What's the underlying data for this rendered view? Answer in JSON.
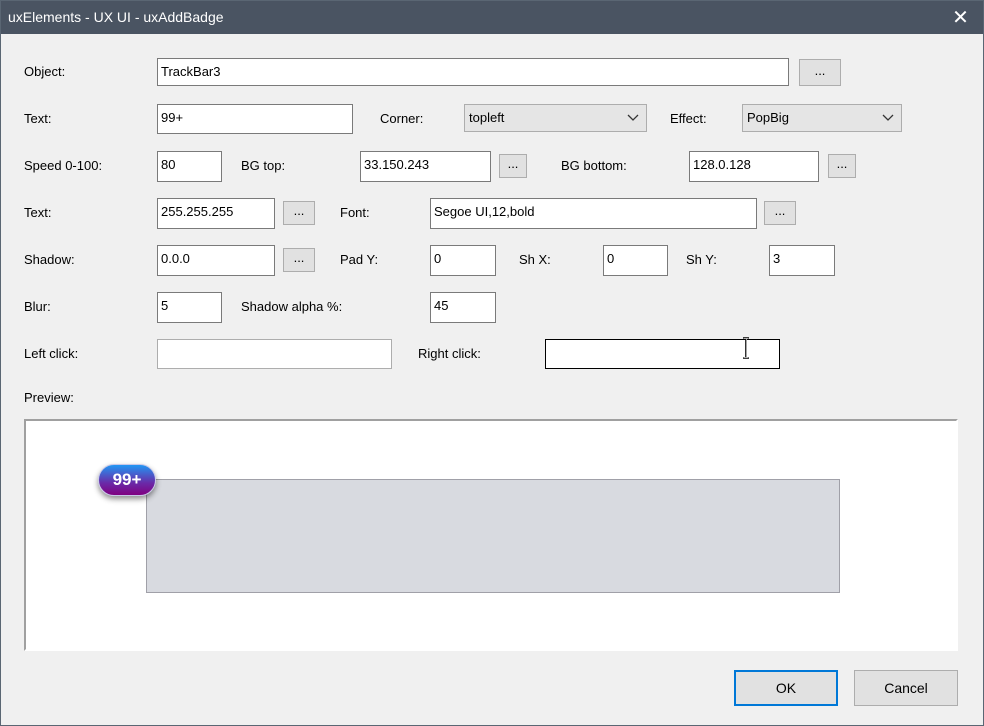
{
  "window": {
    "title": "uxElements - UX UI - uxAddBadge"
  },
  "form": {
    "object_label": "Object:",
    "object_value": "TrackBar3",
    "text_label": "Text:",
    "text_value": "99+",
    "corner_label": "Corner:",
    "corner_value": "topleft",
    "effect_label": "Effect:",
    "effect_value": "PopBig",
    "speed_label": "Speed 0-100:",
    "speed_value": "80",
    "bgtop_label": "BG top:",
    "bgtop_value": "33.150.243",
    "bgbottom_label": "BG bottom:",
    "bgbottom_value": "128.0.128",
    "textcolor_label": "Text:",
    "textcolor_value": "255.255.255",
    "font_label": "Font:",
    "font_value": "Segoe UI,12,bold",
    "shadow_label": "Shadow:",
    "shadow_value": "0.0.0",
    "pady_label": "Pad Y:",
    "pady_value": "0",
    "shx_label": "Sh X:",
    "shx_value": "0",
    "shy_label": "Sh Y:",
    "shy_value": "3",
    "blur_label": "Blur:",
    "blur_value": "5",
    "shalpha_label": "Shadow alpha %:",
    "shalpha_value": "45",
    "leftclick_label": "Left click:",
    "leftclick_value": "",
    "rightclick_label": "Right click:",
    "rightclick_value": "",
    "ellipsis": "..."
  },
  "preview": {
    "label": "Preview:",
    "badge_text": "99+"
  },
  "buttons": {
    "ok": "OK",
    "cancel": "Cancel"
  },
  "colors": {
    "titlebar": "#4a5462",
    "badge_top": "#2196f3",
    "badge_bottom": "#800080",
    "default_button": "#0078d7"
  }
}
